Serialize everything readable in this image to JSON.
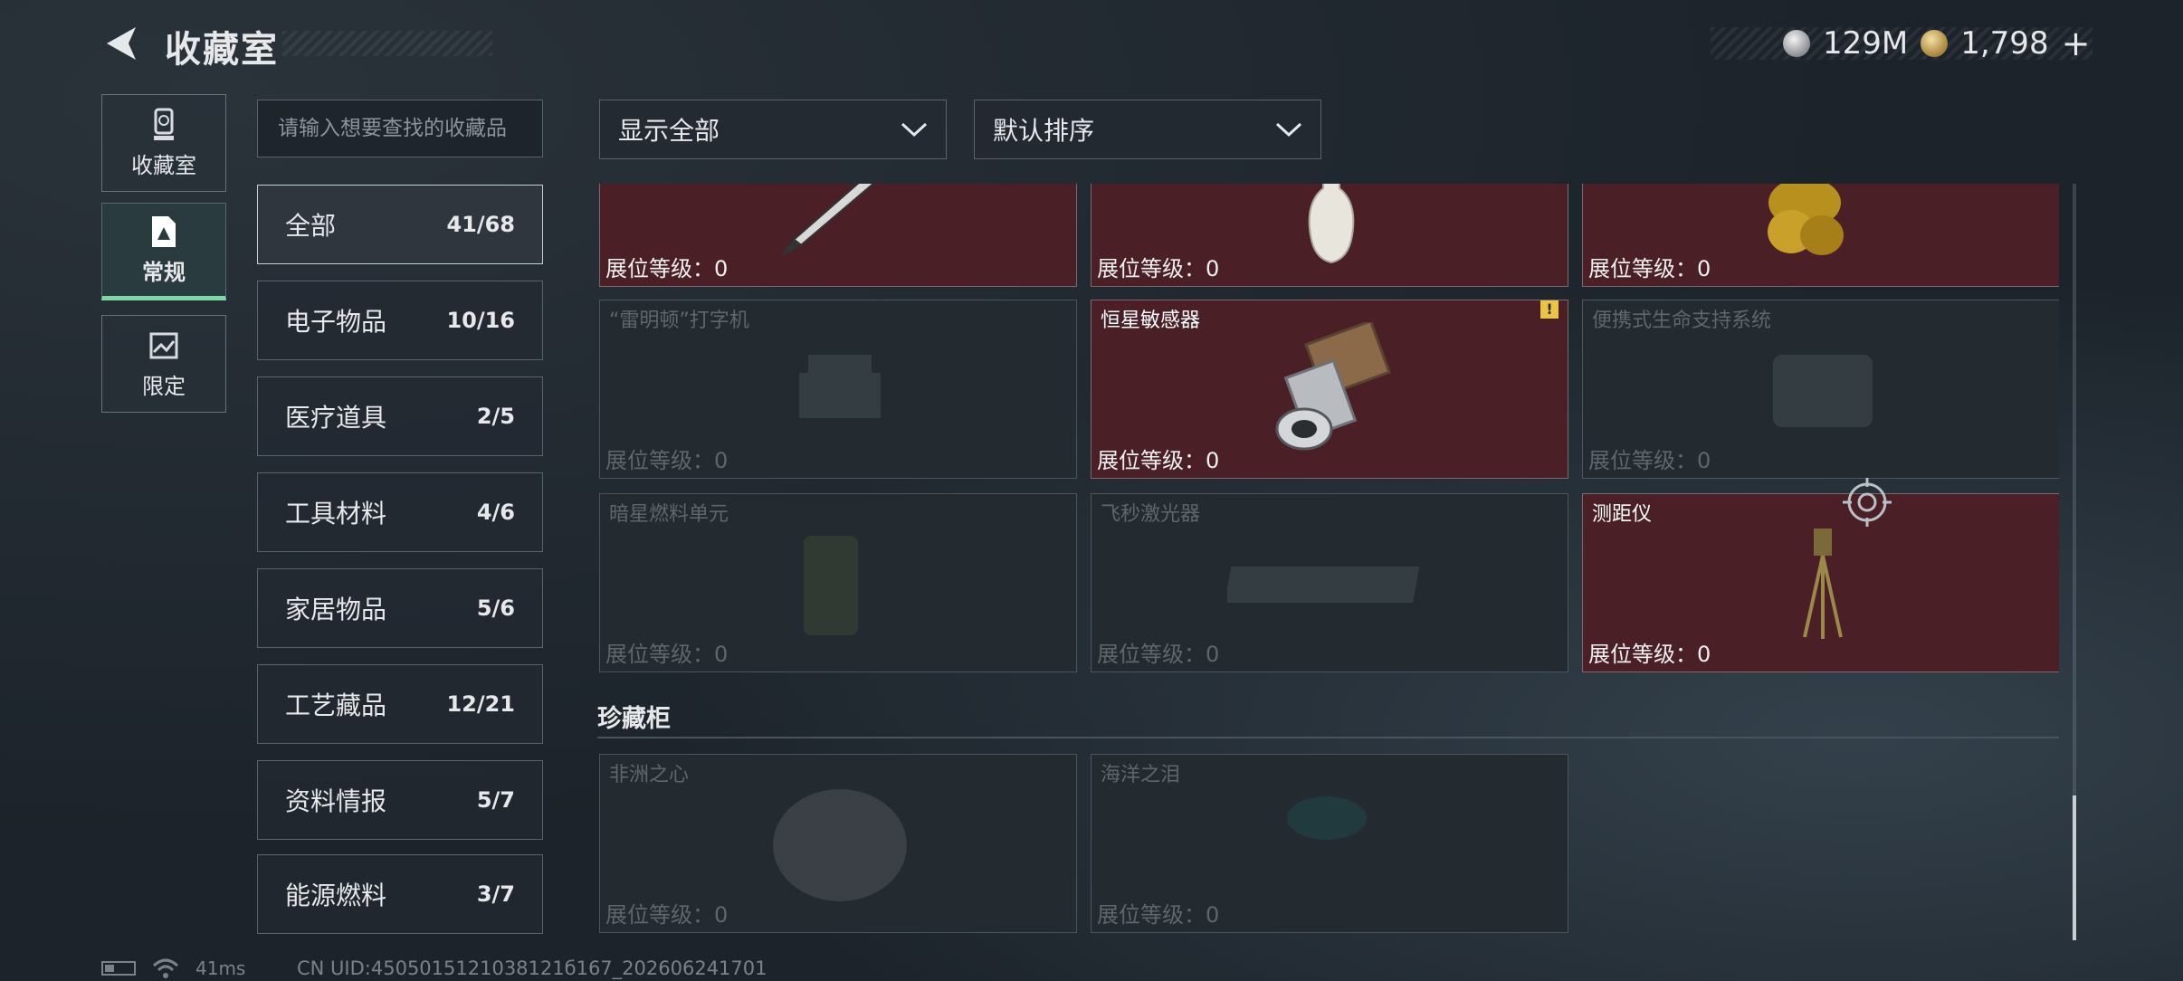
{
  "header": {
    "title": "收藏室",
    "currency": [
      {
        "icon": "silver-coin-icon",
        "value": "129M"
      },
      {
        "icon": "gold-coin-icon",
        "value": "1,798"
      }
    ],
    "add_symbol": "+"
  },
  "side_tabs": [
    {
      "label": "收藏室",
      "icon": "trophy-icon",
      "active": false
    },
    {
      "label": "常规",
      "icon": "document-icon",
      "active": true
    },
    {
      "label": "限定",
      "icon": "image-icon",
      "active": false
    }
  ],
  "search": {
    "placeholder": "请输入想要查找的收藏品"
  },
  "categories": [
    {
      "label": "全部",
      "count": "41/68"
    },
    {
      "label": "电子物品",
      "count": "10/16"
    },
    {
      "label": "医疗道具",
      "count": "2/5"
    },
    {
      "label": "工具材料",
      "count": "4/6"
    },
    {
      "label": "家居物品",
      "count": "5/6"
    },
    {
      "label": "工艺藏品",
      "count": "12/21"
    },
    {
      "label": "资料情报",
      "count": "5/7"
    },
    {
      "label": "能源燃料",
      "count": "3/7"
    }
  ],
  "filters": {
    "show": "显示全部",
    "sort": "默认排序"
  },
  "level_label": "展位等级：",
  "items_top": [
    {
      "name": "",
      "level": "0",
      "owned": true,
      "icon": "fountain-pen-icon"
    },
    {
      "name": "",
      "level": "0",
      "owned": true,
      "icon": "vase-icon"
    },
    {
      "name": "",
      "level": "0",
      "owned": true,
      "icon": "golden-statue-icon"
    },
    {
      "name": "“雷明顿”打字机",
      "level": "0",
      "owned": false,
      "icon": "typewriter-icon"
    },
    {
      "name": "恒星敏感器",
      "level": "0",
      "owned": true,
      "icon": "star-sensor-icon",
      "badge": "!"
    },
    {
      "name": "便携式生命支持系统",
      "level": "0",
      "owned": false,
      "icon": "life-support-icon"
    },
    {
      "name": "暗星燃料单元",
      "level": "0",
      "owned": false,
      "icon": "fuel-cell-icon"
    },
    {
      "name": "飞秒激光器",
      "level": "0",
      "owned": false,
      "icon": "laser-icon"
    },
    {
      "name": "测距仪",
      "level": "0",
      "owned": true,
      "icon": "rangefinder-icon"
    }
  ],
  "section": {
    "title": "珍藏柜"
  },
  "items_cabinet": [
    {
      "name": "非洲之心",
      "level": "0",
      "owned": false,
      "icon": "diamond-icon"
    },
    {
      "name": "海洋之泪",
      "level": "0",
      "owned": false,
      "icon": "gem-icon"
    }
  ],
  "status_bar": {
    "ping": "41ms",
    "uid": "CN UID:4505015121038121б167_202606241701"
  }
}
